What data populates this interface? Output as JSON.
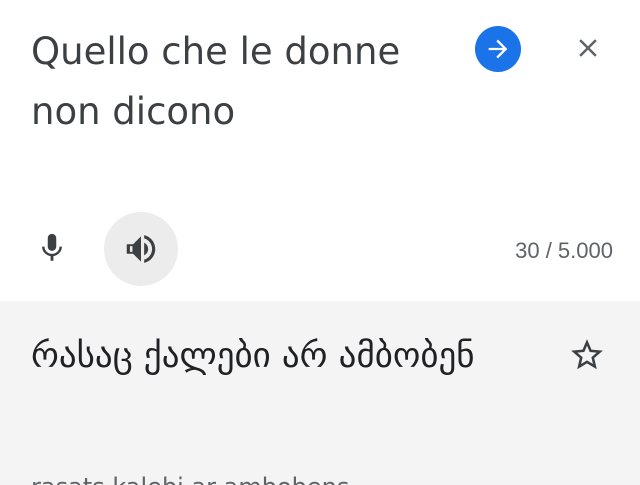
{
  "source": {
    "text": "Quello che le donne non dicono",
    "char_count": "30 / 5.000"
  },
  "result": {
    "text": "რასაც ქალები არ ამბობენ",
    "transliteration": "rasats kalebi ar ambobens"
  },
  "icons": {
    "go": "arrow-forward-icon",
    "close": "close-icon",
    "mic": "microphone-icon",
    "speaker": "volume-icon",
    "star": "star-outline-icon"
  },
  "colors": {
    "accent": "#1a73e8",
    "result_background": "#f4f4f4",
    "text_primary": "#202124",
    "text_secondary": "#5f6368"
  }
}
